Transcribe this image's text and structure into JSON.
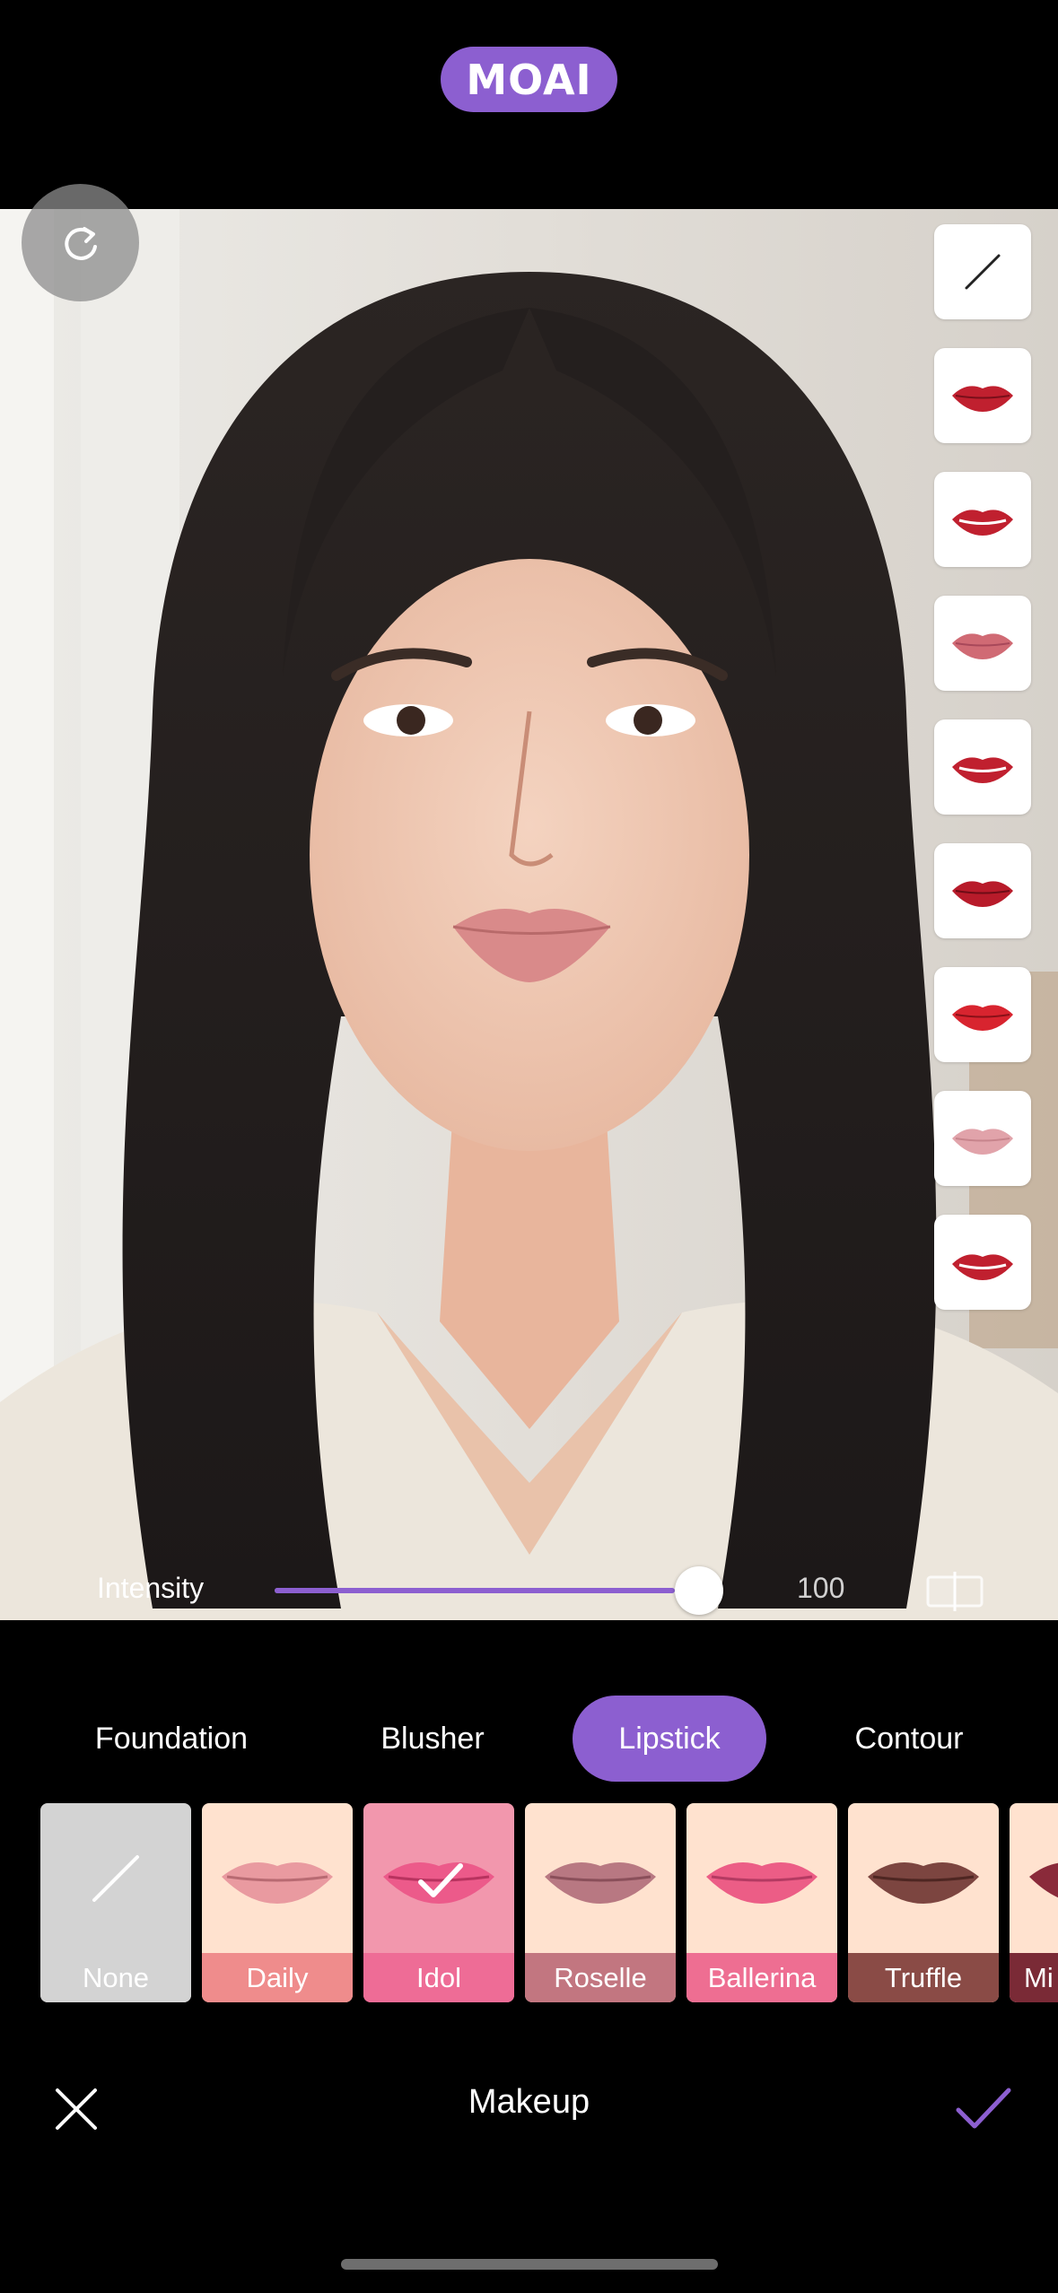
{
  "app": {
    "logo_text": "MOAI",
    "accent": "#8c5fd0"
  },
  "photo": {
    "subject": "portrait"
  },
  "lipstick_swatches": [
    {
      "icon": "none-slash-icon",
      "color": "#222222"
    },
    {
      "icon": "lips-icon",
      "color": "#c0202f"
    },
    {
      "icon": "lips-icon",
      "color": "#c0202f"
    },
    {
      "icon": "lips-icon",
      "color": "#d06a74"
    },
    {
      "icon": "lips-icon",
      "color": "#c0202f"
    },
    {
      "icon": "lips-icon",
      "color": "#b81b2a"
    },
    {
      "icon": "lips-icon",
      "color": "#d8242f"
    },
    {
      "icon": "lips-icon",
      "color": "#e1a3aa"
    },
    {
      "icon": "lips-plus-icon",
      "color": "#c0202f"
    }
  ],
  "intensity": {
    "label": "Intensity",
    "value": "100",
    "fraction": 1.0
  },
  "tabs": [
    {
      "label": "Foundation",
      "active": false
    },
    {
      "label": "Blusher",
      "active": false
    },
    {
      "label": "Lipstick",
      "active": true
    },
    {
      "label": "Contour",
      "active": false
    }
  ],
  "presets": [
    {
      "label": "None",
      "bg": "#d3d3d3",
      "label_bg": "#d3d3d3",
      "lip": "",
      "selected": false
    },
    {
      "label": "Daily",
      "bg": "#ffe2cf",
      "label_bg": "#ef8c8c",
      "lip": "#e99aa0",
      "selected": false
    },
    {
      "label": "Idol",
      "bg": "#f297ad",
      "label_bg": "#ee6c96",
      "lip": "#ec5a8a",
      "selected": true
    },
    {
      "label": "Roselle",
      "bg": "#ffe2cf",
      "label_bg": "#c27680",
      "lip": "#b87882",
      "selected": false
    },
    {
      "label": "Ballerina",
      "bg": "#ffe2cf",
      "label_bg": "#ee6e92",
      "lip": "#ec5d86",
      "selected": false
    },
    {
      "label": "Truffle",
      "bg": "#ffe2cf",
      "label_bg": "#8a4b46",
      "lip": "#7c4540",
      "selected": false
    },
    {
      "label": "Mi",
      "bg": "#ffe2cf",
      "label_bg": "#7a2a36",
      "lip": "#8a2a3a",
      "selected": false
    }
  ],
  "bottom_bar": {
    "title": "Makeup"
  }
}
